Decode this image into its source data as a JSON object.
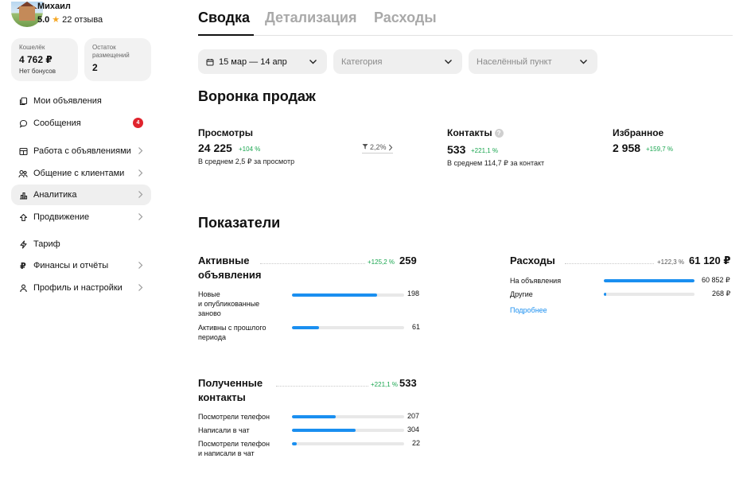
{
  "profile": {
    "name": "Михаил",
    "rating": "5.0",
    "reviews": "22 отзыва"
  },
  "wallet": {
    "caption": "Кошелёк",
    "amount": "4 762 ₽",
    "note": "Нет бонусов"
  },
  "placements": {
    "caption": "Остаток размещений",
    "count": "2"
  },
  "sidebar": {
    "items": [
      {
        "label": "Мои объявления",
        "icon": "copy-icon"
      },
      {
        "label": "Сообщения",
        "icon": "chat-icon",
        "badge": "4"
      },
      {
        "label": "Работа с объявлениями",
        "icon": "grid-icon"
      },
      {
        "label": "Общение с клиентами",
        "icon": "people-icon"
      },
      {
        "label": "Аналитика",
        "icon": "chart-icon"
      },
      {
        "label": "Продвижение",
        "icon": "promote-icon"
      },
      {
        "label": "Тариф",
        "icon": "tariff-icon"
      },
      {
        "label": "Финансы и отчёты",
        "icon": "ruble-icon"
      },
      {
        "label": "Профиль и настройки",
        "icon": "user-icon"
      }
    ]
  },
  "tabs": [
    "Сводка",
    "Детализация",
    "Расходы"
  ],
  "filters": {
    "period": "15 мар — 14 апр",
    "category_placeholder": "Категория",
    "city_placeholder": "Населённый пункт"
  },
  "funnel": {
    "title": "Воронка продаж",
    "conversion": "2,2%",
    "views": {
      "label": "Просмотры",
      "value": "24 225",
      "delta": "+104 %",
      "note": "В среднем 2,5 ₽ за просмотр"
    },
    "contacts": {
      "label": "Контакты",
      "value": "533",
      "delta": "+221,1 %",
      "note": "В среднем 114,7 ₽ за контакт"
    },
    "favorites": {
      "label": "Избранное",
      "value": "2 958",
      "delta": "+159,7 %"
    }
  },
  "indicators": {
    "title": "Показатели",
    "active": {
      "title_line1": "Активные",
      "title_line2": "объявления",
      "delta": "+125,2 %",
      "total": "259",
      "rows": [
        {
          "label_lines": [
            "Новые",
            "и опубликованные",
            "заново"
          ],
          "value": "198",
          "share": 0.76
        },
        {
          "label_lines": [
            "Активны с прошлого",
            "периода"
          ],
          "value": "61",
          "share": 0.24
        }
      ]
    },
    "contacts": {
      "title_line1": "Полученные",
      "title_line2": "контакты",
      "delta": "+221,1 %",
      "total": "533",
      "rows": [
        {
          "label_lines": [
            "Посмотрели телефон"
          ],
          "value": "207",
          "share": 0.39
        },
        {
          "label_lines": [
            "Написали в чат"
          ],
          "value": "304",
          "share": 0.57
        },
        {
          "label_lines": [
            "Посмотрели телефон",
            "и написали в чат"
          ],
          "value": "22",
          "share": 0.04
        }
      ]
    },
    "expenses": {
      "title": "Расходы",
      "delta": "+122,3 %",
      "total": "61 120 ₽",
      "rows": [
        {
          "label": "На объявления",
          "value": "60 852 ₽",
          "share": 0.996
        },
        {
          "label": "Другие",
          "value": "268 ₽",
          "share": 0.03
        }
      ],
      "more_link": "Подробнее"
    }
  },
  "colors": {
    "accent": "#1a8ff0",
    "positive": "#1aa650",
    "badge": "#e0242d"
  }
}
